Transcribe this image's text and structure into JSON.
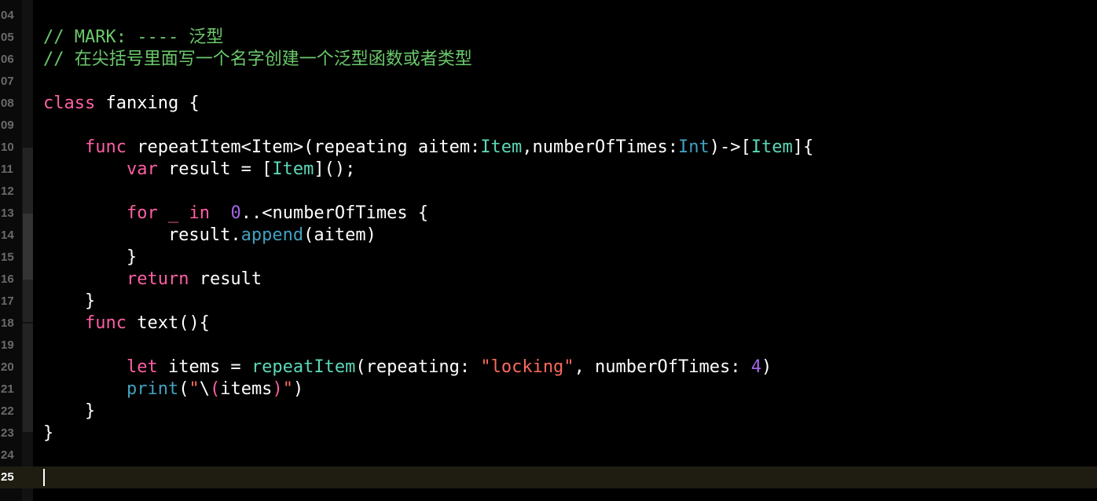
{
  "editor": {
    "colors": {
      "background": "#000000",
      "current_line": "#1f1c12",
      "keyword": "#fc5fa3",
      "type": "#5dd8b8",
      "function": "#41a1c0",
      "number": "#a167e6",
      "string": "#fc6a5d",
      "comment": "#6bc96b"
    },
    "current_line_number": "25",
    "lines": [
      {
        "number": "04",
        "tokens": []
      },
      {
        "number": "05",
        "tokens": [
          {
            "t": "cm",
            "v": "// MARK: ---- 泛型"
          }
        ]
      },
      {
        "number": "06",
        "tokens": [
          {
            "t": "cm",
            "v": "// 在尖括号里面写一个名字创建一个泛型函数或者类型"
          }
        ]
      },
      {
        "number": "07",
        "tokens": []
      },
      {
        "number": "08",
        "tokens": [
          {
            "t": "kw",
            "v": "class"
          },
          {
            "t": "plain",
            "v": " fanxing {"
          }
        ]
      },
      {
        "number": "09",
        "tokens": []
      },
      {
        "number": "10",
        "tokens": [
          {
            "t": "plain",
            "v": "    "
          },
          {
            "t": "kw",
            "v": "func"
          },
          {
            "t": "plain",
            "v": " repeatItem<Item>(repeating aitem:"
          },
          {
            "t": "type",
            "v": "Item"
          },
          {
            "t": "plain",
            "v": ",numberOfTimes:"
          },
          {
            "t": "blue",
            "v": "Int"
          },
          {
            "t": "plain",
            "v": ")->["
          },
          {
            "t": "type",
            "v": "Item"
          },
          {
            "t": "plain",
            "v": "]{"
          }
        ]
      },
      {
        "number": "11",
        "tokens": [
          {
            "t": "plain",
            "v": "        "
          },
          {
            "t": "kw",
            "v": "var"
          },
          {
            "t": "plain",
            "v": " result = ["
          },
          {
            "t": "type",
            "v": "Item"
          },
          {
            "t": "plain",
            "v": "]();"
          }
        ]
      },
      {
        "number": "12",
        "tokens": []
      },
      {
        "number": "13",
        "tokens": [
          {
            "t": "plain",
            "v": "        "
          },
          {
            "t": "kw",
            "v": "for"
          },
          {
            "t": "plain",
            "v": " "
          },
          {
            "t": "kw",
            "v": "_"
          },
          {
            "t": "plain",
            "v": " "
          },
          {
            "t": "kw",
            "v": "in"
          },
          {
            "t": "plain",
            "v": "  "
          },
          {
            "t": "num",
            "v": "0"
          },
          {
            "t": "plain",
            "v": "..<numberOfTimes {"
          }
        ]
      },
      {
        "number": "14",
        "tokens": [
          {
            "t": "plain",
            "v": "            result."
          },
          {
            "t": "blue",
            "v": "append"
          },
          {
            "t": "plain",
            "v": "(aitem)"
          }
        ]
      },
      {
        "number": "15",
        "tokens": [
          {
            "t": "plain",
            "v": "        }"
          }
        ]
      },
      {
        "number": "16",
        "tokens": [
          {
            "t": "plain",
            "v": "        "
          },
          {
            "t": "kw",
            "v": "return"
          },
          {
            "t": "plain",
            "v": " result"
          }
        ]
      },
      {
        "number": "17",
        "tokens": [
          {
            "t": "plain",
            "v": "    }"
          }
        ]
      },
      {
        "number": "18",
        "tokens": [
          {
            "t": "plain",
            "v": "    "
          },
          {
            "t": "kw",
            "v": "func"
          },
          {
            "t": "plain",
            "v": " text(){"
          }
        ]
      },
      {
        "number": "19",
        "tokens": []
      },
      {
        "number": "20",
        "tokens": [
          {
            "t": "plain",
            "v": "        "
          },
          {
            "t": "kw",
            "v": "let"
          },
          {
            "t": "plain",
            "v": " items = "
          },
          {
            "t": "type",
            "v": "repeatItem"
          },
          {
            "t": "plain",
            "v": "(repeating: "
          },
          {
            "t": "str",
            "v": "\"locking\""
          },
          {
            "t": "plain",
            "v": ", numberOfTimes: "
          },
          {
            "t": "num",
            "v": "4"
          },
          {
            "t": "plain",
            "v": ")"
          }
        ]
      },
      {
        "number": "21",
        "tokens": [
          {
            "t": "plain",
            "v": "        "
          },
          {
            "t": "blue",
            "v": "print"
          },
          {
            "t": "plain",
            "v": "("
          },
          {
            "t": "str",
            "v": "\""
          },
          {
            "t": "plain",
            "v": "\\"
          },
          {
            "t": "ip",
            "v": "("
          },
          {
            "t": "plain",
            "v": "items"
          },
          {
            "t": "ip",
            "v": ")"
          },
          {
            "t": "str",
            "v": "\""
          },
          {
            "t": "plain",
            "v": ")"
          }
        ]
      },
      {
        "number": "22",
        "tokens": [
          {
            "t": "plain",
            "v": "    }"
          }
        ]
      },
      {
        "number": "23",
        "tokens": [
          {
            "t": "plain",
            "v": "}"
          }
        ]
      },
      {
        "number": "24",
        "tokens": []
      },
      {
        "number": "25",
        "tokens": []
      }
    ]
  }
}
